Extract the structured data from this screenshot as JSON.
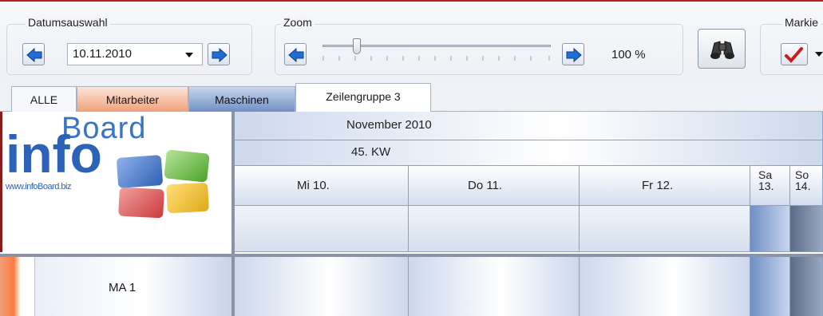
{
  "toolbar": {
    "date_group_label": "Datumsauswahl",
    "date_value": "10.11.2010",
    "zoom_group_label": "Zoom",
    "zoom_percent_label": "100 %",
    "zoom_level": 0.15,
    "mark_group_label": "Markie"
  },
  "tabs": [
    "ALLE",
    "Mitarbeiter",
    "Maschinen",
    "Zeilengruppe 3"
  ],
  "logo": {
    "word_board": "Board",
    "word_info": "info",
    "url_text": "www.infoBoard.biz"
  },
  "calendar": {
    "month": "November 2010",
    "week": "45. KW",
    "days": [
      {
        "label": "Mi 10."
      },
      {
        "label": "Do 11."
      },
      {
        "label": "Fr 12."
      },
      {
        "label": "Sa 13."
      },
      {
        "label": "So 14."
      }
    ]
  },
  "rows": [
    {
      "label": "MA 1"
    }
  ],
  "colors": {
    "accent_red": "#b22222",
    "mitarbeiter_tab": "#f0a07a",
    "maschinen_tab": "#6f8fc4",
    "weekend": "#6f8fc4"
  },
  "icons": [
    "arrow-left-icon",
    "arrow-right-icon",
    "binoculars-icon",
    "checkmark-icon",
    "dropdown-arrow-icon"
  ]
}
